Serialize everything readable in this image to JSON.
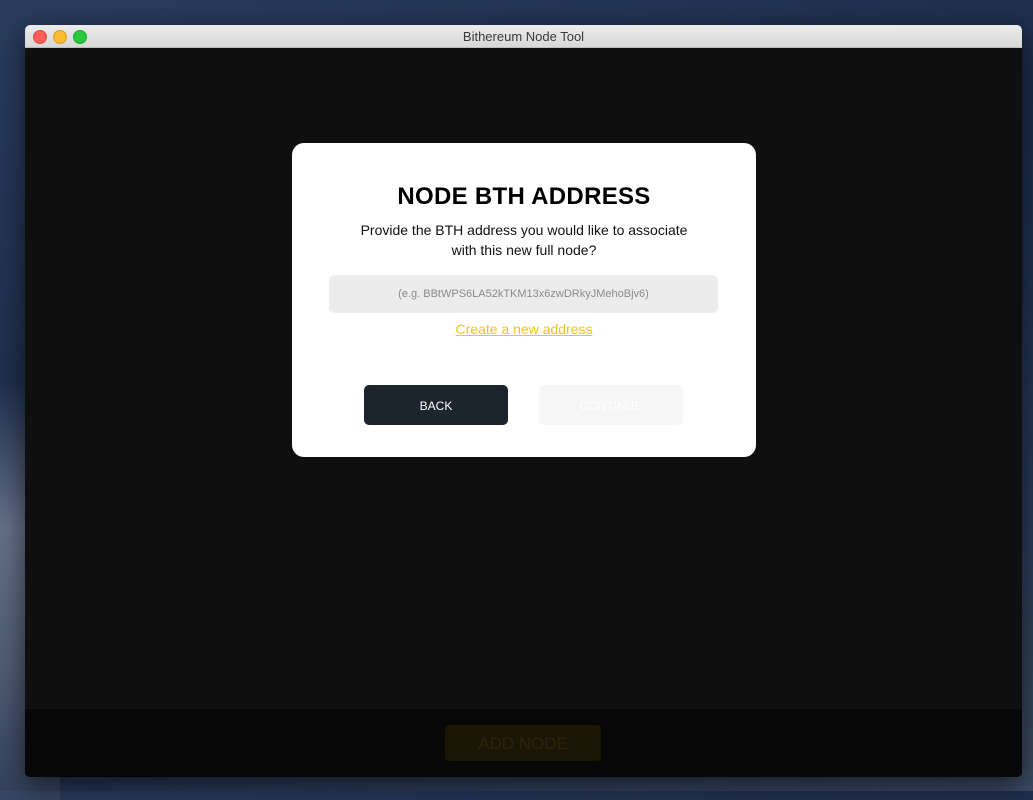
{
  "window": {
    "title": "Bithereum Node Tool"
  },
  "modal": {
    "title": "NODE BTH ADDRESS",
    "description": "Provide the BTH address you would like to associate with this new full node?",
    "address_input": {
      "value": "",
      "placeholder": "(e.g. BBtWPS6LA52kTKM13x6zwDRkyJMehoBjv6)"
    },
    "create_link": "Create a new address",
    "back_label": "BACK",
    "continue_label": "CONTINUE"
  },
  "footer": {
    "add_node_label": "ADD NODE"
  },
  "colors": {
    "accent": "#f3c227",
    "back_button": "#1c242d",
    "continue_button_disabled": "#f6f6f6",
    "window_background": "#0f0f0f"
  }
}
